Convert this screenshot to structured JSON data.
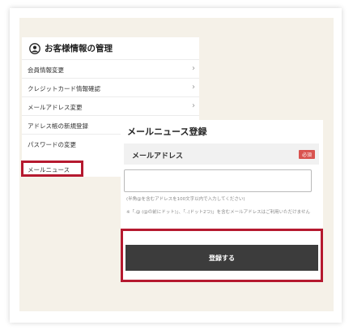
{
  "account_menu": {
    "title": "お客様情報の管理",
    "header_icon": "user-circle-icon",
    "items": [
      {
        "label": "会員情報変更",
        "chevron": "›"
      },
      {
        "label": "クレジットカード情報確認",
        "chevron": "›"
      },
      {
        "label": "メールアドレス変更",
        "chevron": "›"
      },
      {
        "label": "アドレス帳の新規登録",
        "chevron": ""
      },
      {
        "label": "パスワードの変更",
        "chevron": ""
      },
      {
        "label": "メールニュース",
        "chevron": ""
      }
    ]
  },
  "news_registration": {
    "title": "メールニュース登録",
    "field_label": "メールアドレス",
    "required_badge": "必須",
    "email_value": "",
    "hint": "(半角@を含むアドレスを100文字以内で入力してください)",
    "note": "※「.@ (@の前にドット)」、「..(ドット2つ)」を含むメールアドレスはご利用いただけません",
    "submit_label": "登録する"
  },
  "colors": {
    "highlight": "#b5192f",
    "background": "#f5f1e8",
    "button": "#3c3c3c",
    "required": "#d9534f"
  }
}
